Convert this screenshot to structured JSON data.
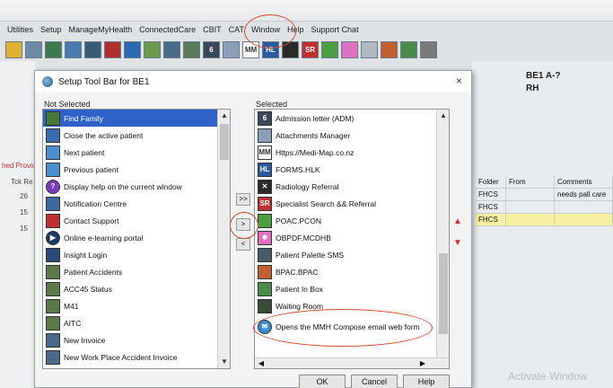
{
  "menu": [
    "Utilities",
    "Setup",
    "ManageMyHealth",
    "ConnectedCare",
    "CBIT",
    "CAT",
    "Window",
    "Help",
    "Support Chat"
  ],
  "toolbar_icons": [
    "history-icon",
    "scan-icon",
    "patient-icon",
    "inbox-icon",
    "notes-icon",
    "ncd-icon",
    "ppp-icon",
    "family-icon",
    "form-icon",
    "form2-icon",
    "admission-icon",
    "attachment-icon",
    "medimap-icon",
    "hlk-icon",
    "radiology-icon",
    "sr-icon",
    "poac-icon",
    "opbf-icon",
    "blank-icon",
    "palette-icon",
    "bpac-icon",
    "house-icon"
  ],
  "app_title": {
    "line1": "BE1 A-?",
    "line2": "RH"
  },
  "background_table": {
    "headers": [
      "Folder",
      "From",
      "Comments"
    ],
    "rows": [
      [
        "FHCS",
        "",
        "needs pall care"
      ],
      [
        "FHCS",
        "",
        ""
      ],
      [
        "FHCS",
        "",
        ""
      ]
    ]
  },
  "left_fragments": [
    "hed Provic",
    "Tck Re",
    "26",
    "15",
    "15"
  ],
  "watermark": "Activate Window",
  "dialog": {
    "title": "Setup Tool Bar for BE1",
    "close": "×",
    "not_selected_label": "Not Selected",
    "selected_label": "Selected",
    "not_selected": [
      "Find Family",
      "Close the active patient",
      "Next patient",
      "Previous patient",
      "Display help on the current window",
      "Notification Centre",
      "Contact Support",
      "Online e-learning portal",
      "Insight Login",
      "Patient Accidents",
      "ACC45 Status",
      "M41",
      "AITC",
      "New Invoice",
      "New Work Place Accident Invoice"
    ],
    "selected": [
      "Admission letter (ADM)",
      "Attachments Manager",
      "Https://Medi-Map.co.nz",
      "FORMS.HLK",
      "Radiology Referral",
      "Specialist Search && Referral",
      "POAC.PCON",
      "OBPDF.MCDHB",
      "Patient Palette SMS",
      "BPAC.BPAC",
      "Patient In Box",
      "Waiting Room",
      "Opens the MMH Compose email web form"
    ],
    "move_buttons": [
      ">>",
      ">",
      "<"
    ],
    "buttons": {
      "ok": "OK",
      "cancel": "Cancel",
      "help": "Help"
    },
    "icon_glyphs": {
      "admission": "6",
      "medimap": "MM",
      "hlk": "HL",
      "sr": "SR"
    }
  },
  "colors": {
    "selection": "#2f62c8",
    "highlight_row": "#f6f0a0",
    "annotation": "#d64a2e",
    "arrow": "#cc3333"
  }
}
